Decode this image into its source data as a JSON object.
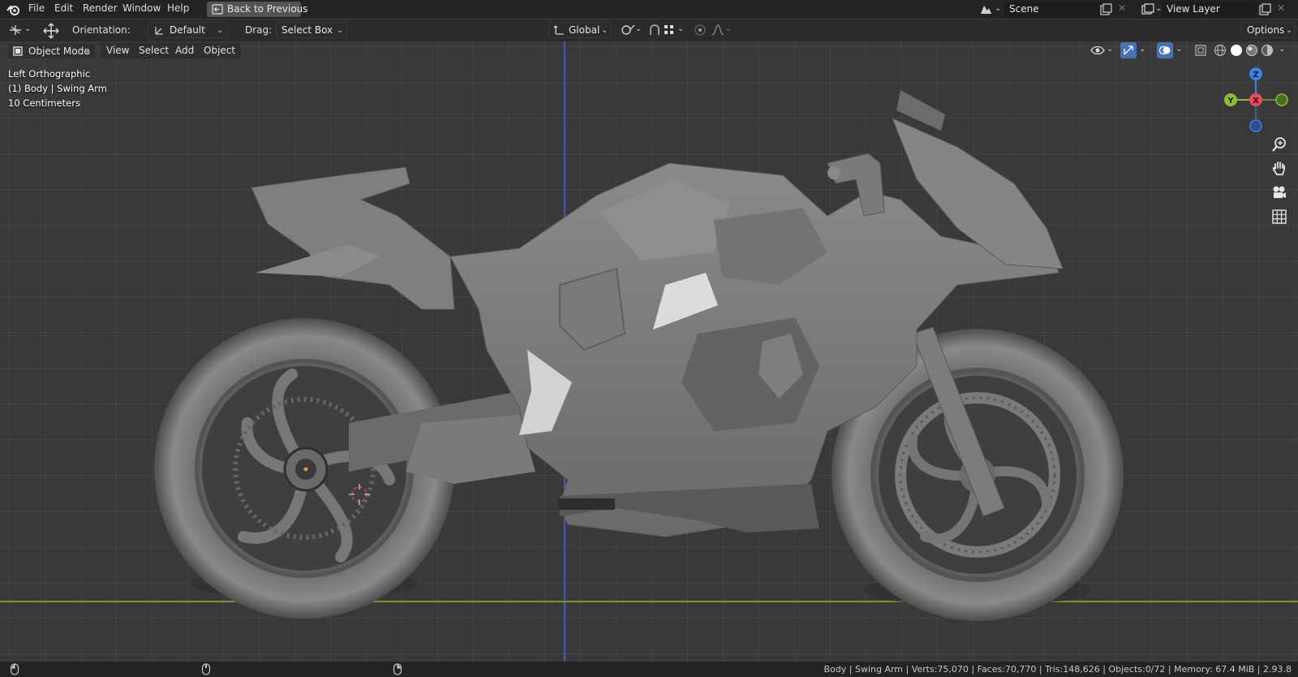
{
  "topbar": {
    "menus": [
      "File",
      "Edit",
      "Render",
      "Window",
      "Help"
    ],
    "back_button": "Back to Previous",
    "scene_value": "Scene",
    "view_layer_value": "View Layer"
  },
  "toolheader": {
    "orientation_label": "Orientation:",
    "orientation_value": "Default",
    "drag_label": "Drag:",
    "drag_value": "Select Box",
    "transform_orientation": "Global",
    "options_label": "Options"
  },
  "viewport_header": {
    "mode": "Object Mode",
    "menus": [
      "View",
      "Select",
      "Add",
      "Object"
    ]
  },
  "overlay": {
    "view_name": "Left Orthographic",
    "active_object": "(1) Body | Swing Arm",
    "grid_scale": "10 Centimeters"
  },
  "gizmo": {
    "z": "Z",
    "y": "Y",
    "x": "X"
  },
  "statusbar": {
    "stats": "Body | Swing Arm | Verts:75,070 | Faces:70,770 | Tris:148,626 | Objects:0/72 | Memory: 67.4 MiB | 2.93.8"
  },
  "colors": {
    "axis_z_blue": "#3b5fb8",
    "axis_y_green": "#7aa53a",
    "gizmo_x": "#e84a5f",
    "gizmo_y": "#8bbf3a",
    "gizmo_z": "#3d82e0"
  },
  "icons": [
    "blender-logo-icon",
    "back-icon",
    "scene-icon",
    "view-layer-icon",
    "move-icon",
    "orientation-icon",
    "link-icon",
    "snap-icon",
    "proportional-icon",
    "visibility-icon",
    "gizmo-icon",
    "overlay-icon",
    "xray-icon",
    "wireframe-icon",
    "solid-icon",
    "material-icon",
    "rendered-icon",
    "zoom-icon",
    "hand-icon",
    "camera-icon",
    "grid-icon",
    "mouse-icon"
  ]
}
